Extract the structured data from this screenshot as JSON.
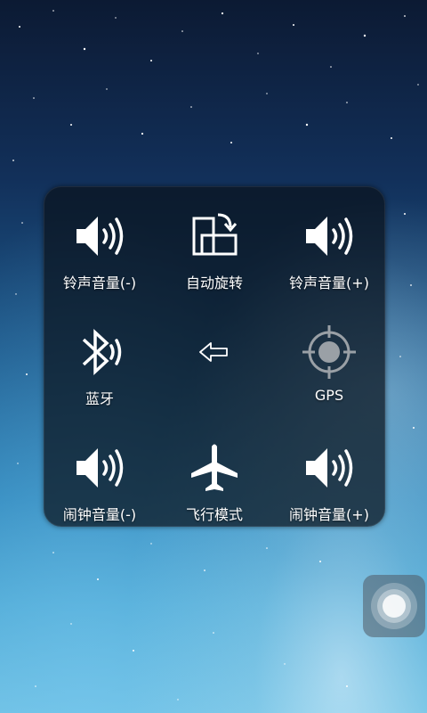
{
  "panel": {
    "tiles": [
      {
        "label": "铃声音量(-)",
        "icon": "speaker-volume-icon"
      },
      {
        "label": "自动旋转",
        "icon": "auto-rotate-icon"
      },
      {
        "label": "铃声音量(+)",
        "icon": "speaker-volume-icon"
      },
      {
        "label": "蓝牙",
        "icon": "bluetooth-icon"
      },
      {
        "label": "",
        "icon": "back-arrow-icon"
      },
      {
        "label": "GPS",
        "icon": "gps-icon"
      },
      {
        "label": "闹钟音量(-)",
        "icon": "speaker-volume-icon"
      },
      {
        "label": "飞行模式",
        "icon": "airplane-icon"
      },
      {
        "label": "闹钟音量(+)",
        "icon": "speaker-volume-icon"
      }
    ]
  },
  "assistive_button": {
    "icon": "assistive-touch-icon"
  },
  "colors": {
    "panel_bg": "#0a121c",
    "icon": "#ffffff",
    "gps_inactive": "#9aa0a6"
  }
}
